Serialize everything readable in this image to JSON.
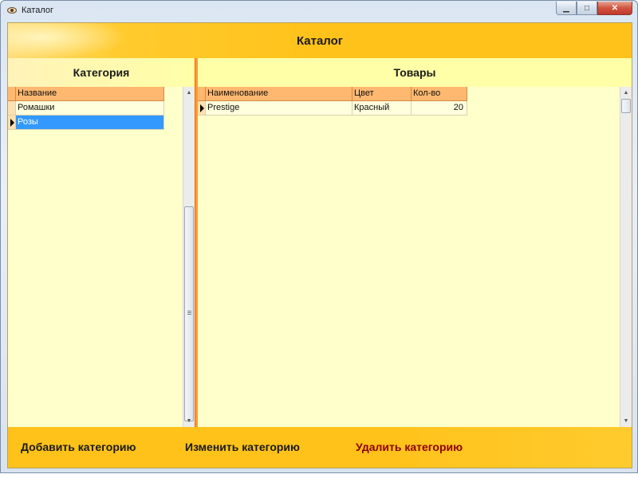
{
  "window": {
    "title": "Каталог",
    "icon": "eye-icon",
    "controls": [
      "minimize-icon",
      "maximize-icon",
      "close-icon"
    ],
    "close_glyph": "✕",
    "min_glyph": "▁",
    "max_glyph": "□"
  },
  "header": {
    "title": "Каталог"
  },
  "categories": {
    "title": "Категория",
    "columns": [
      "Название"
    ],
    "rows": [
      {
        "name": "Ромашки",
        "selected": false
      },
      {
        "name": "Розы",
        "selected": true
      }
    ]
  },
  "products": {
    "title": "Товары",
    "columns": [
      "Наименование",
      "Цвет",
      "Кол-во"
    ],
    "rows": [
      {
        "name": "Prestige",
        "color": "Красный",
        "qty": "20",
        "current": true
      }
    ]
  },
  "footer": {
    "add_label": "Добавить категорию",
    "edit_label": "Изменить категорию",
    "delete_label": "Удалить категорию"
  },
  "colors": {
    "band": "#ffc21a",
    "panel_bg": "#ffffcc",
    "panel_header": "#ffffa8",
    "grid_header": "#ffb870",
    "selection": "#3399ff",
    "splitter": "#ff9933",
    "delete_text": "#8b0000"
  }
}
